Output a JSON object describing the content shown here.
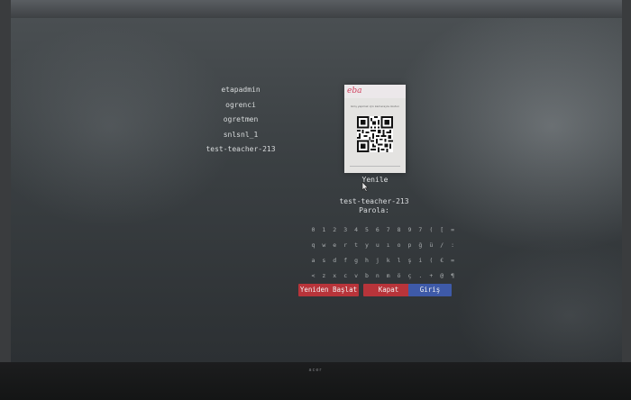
{
  "brand": "acer",
  "users": [
    "etapadmin",
    "ogrenci",
    "ogretmen",
    "snlsnl_1",
    "test-teacher-213"
  ],
  "qr_panel": {
    "logo": "eba",
    "caption": "Giriş yapmak için kamerayla okutun"
  },
  "refresh_label": "Yenile",
  "selected_user": "test-teacher-213",
  "password_label": "Parola:",
  "keyboard": {
    "rows": [
      [
        "0",
        "1",
        "2",
        "3",
        "4",
        "5",
        "6",
        "7",
        "8",
        "9",
        "7",
        "(",
        "[",
        "="
      ],
      [
        "q",
        "w",
        "e",
        "r",
        "t",
        "y",
        "u",
        "ı",
        "o",
        "p",
        "ğ",
        "ü",
        "/",
        ":"
      ],
      [
        "a",
        "s",
        "d",
        "f",
        "g",
        "h",
        "j",
        "k",
        "l",
        "ş",
        "i",
        "(",
        "€",
        "="
      ],
      [
        "<",
        "z",
        "x",
        "c",
        "v",
        "b",
        "n",
        "m",
        "ö",
        "ç",
        ".",
        "+",
        "@",
        "¶"
      ]
    ]
  },
  "buttons": {
    "restart": "Yeniden Başlat",
    "close": "Kapat",
    "login": "Giriş"
  }
}
